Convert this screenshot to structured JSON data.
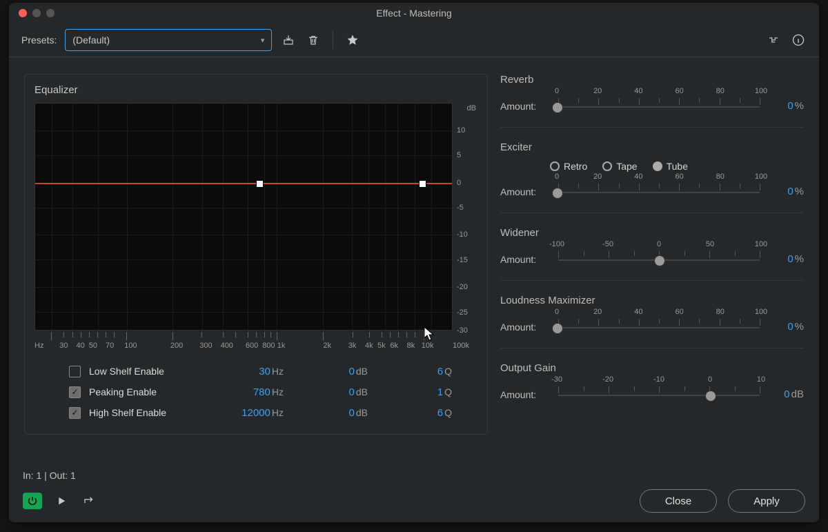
{
  "window": {
    "title": "Effect - Mastering"
  },
  "toolbar": {
    "presets_label": "Presets:",
    "selected_preset": "(Default)"
  },
  "equalizer": {
    "title": "Equalizer",
    "y_unit": "dB",
    "x_unit": "Hz",
    "y_ticks": [
      "10",
      "5",
      "0",
      "-5",
      "-10",
      "-15",
      "-20",
      "-25",
      "-30"
    ],
    "x_ticks": [
      "30",
      "40",
      "50",
      "70",
      "100",
      "200",
      "300",
      "400",
      "600",
      "800",
      "1k",
      "2k",
      "3k",
      "4k",
      "5k",
      "6k",
      "8k",
      "10k",
      "100k"
    ],
    "rows": [
      {
        "enabled": false,
        "label": "Low Shelf Enable",
        "freq": "30",
        "freq_unit": "Hz",
        "gain": "0",
        "gain_unit": "dB",
        "q": "6",
        "q_unit": "Q"
      },
      {
        "enabled": true,
        "label": "Peaking Enable",
        "freq": "780",
        "freq_unit": "Hz",
        "gain": "0",
        "gain_unit": "dB",
        "q": "1",
        "q_unit": "Q"
      },
      {
        "enabled": true,
        "label": "High Shelf Enable",
        "freq": "12000",
        "freq_unit": "Hz",
        "gain": "0",
        "gain_unit": "dB",
        "q": "6",
        "q_unit": "Q"
      }
    ]
  },
  "reverb": {
    "title": "Reverb",
    "amount_label": "Amount:",
    "ticks": [
      "0",
      "20",
      "40",
      "60",
      "80",
      "100"
    ],
    "value": "0",
    "unit": "%"
  },
  "exciter": {
    "title": "Exciter",
    "amount_label": "Amount:",
    "ticks": [
      "0",
      "20",
      "40",
      "60",
      "80",
      "100"
    ],
    "value": "0",
    "unit": "%",
    "modes": {
      "retro": "Retro",
      "tape": "Tape",
      "tube": "Tube"
    },
    "selected": "Tube"
  },
  "widener": {
    "title": "Widener",
    "amount_label": "Amount:",
    "ticks": [
      "-100",
      "-50",
      "0",
      "50",
      "100"
    ],
    "value": "0",
    "unit": "%"
  },
  "loudness": {
    "title": "Loudness Maximizer",
    "amount_label": "Amount:",
    "ticks": [
      "0",
      "20",
      "40",
      "60",
      "80",
      "100"
    ],
    "value": "0",
    "unit": "%"
  },
  "output": {
    "title": "Output Gain",
    "amount_label": "Amount:",
    "ticks": [
      "-30",
      "-20",
      "-10",
      "0",
      "10"
    ],
    "value": "0",
    "unit": "dB"
  },
  "footer": {
    "io": "In: 1 | Out: 1",
    "close": "Close",
    "apply": "Apply"
  }
}
